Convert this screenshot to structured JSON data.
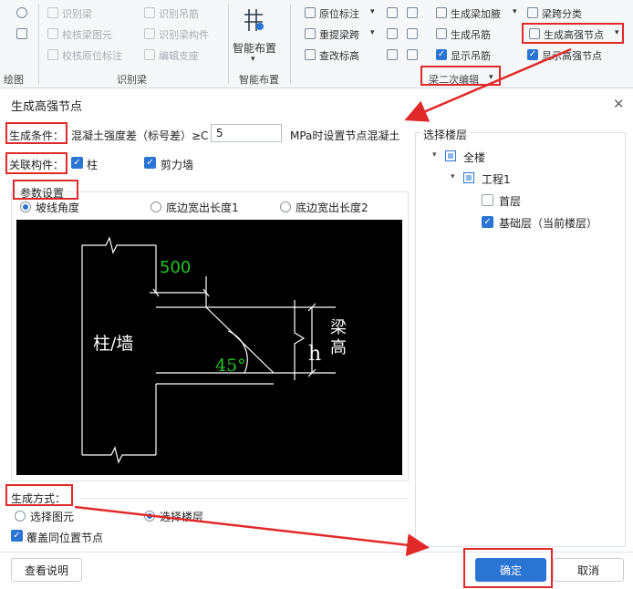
{
  "ribbon": {
    "identify_beam": {
      "items": [
        "识别梁",
        "识别吊筋",
        "校核梁图元",
        "识别梁构件",
        "校核原位标注",
        "编辑支座"
      ],
      "group_label": "识别梁"
    },
    "left_group_label": "绘图",
    "smart_layout": {
      "label": "智能布置",
      "group_label": "智能布置"
    },
    "beam_edit": {
      "items": [
        "原位标注",
        "重提梁跨",
        "查改标高"
      ],
      "group_label": "梁二次编辑"
    },
    "gen_items": [
      "生成梁加腋",
      "生成吊筋",
      "显示吊筋"
    ],
    "right_items": [
      "梁跨分类",
      "生成高强节点",
      "显示高强节点"
    ]
  },
  "dialog": {
    "title": "生成高强节点",
    "condition": {
      "label": "生成条件：",
      "text_before": "混凝土强度差（标号差）≥C",
      "value": "5",
      "text_after": "MPa时设置节点混凝土"
    },
    "members": {
      "label": "关联构件：",
      "column": "柱",
      "shear_wall": "剪力墙"
    },
    "params": {
      "label": "参数设置",
      "options": [
        "坡线角度",
        "底边宽出长度1",
        "底边宽出长度2"
      ],
      "selected": 0
    },
    "diagram": {
      "dim_500": "500",
      "column_wall": "柱/墙",
      "angle": "45°",
      "h": "h",
      "beam_height_1": "梁",
      "beam_height_2": "高"
    },
    "method": {
      "label": "生成方式：",
      "options": [
        "选择图元",
        "选择楼层"
      ],
      "selected": 1,
      "overwrite": "覆盖同位置节点"
    },
    "floors": {
      "label": "选择楼层",
      "all": "全楼",
      "project": "工程1",
      "first": "首层",
      "base": "基础层（当前楼层）"
    },
    "buttons": {
      "help": "查看说明",
      "ok": "确定",
      "cancel": "取消"
    }
  },
  "colors": {
    "accent": "#2a74d4",
    "highlight": "#e02a2a",
    "diagram_bg": "#000000",
    "diagram_green": "#22c422"
  }
}
